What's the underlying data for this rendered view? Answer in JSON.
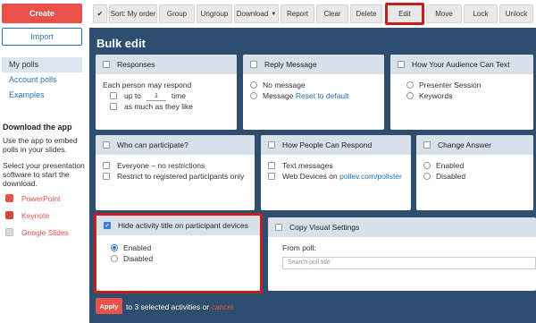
{
  "sidebar": {
    "create_label": "Create",
    "import_label": "Import",
    "nav": [
      {
        "label": "My polls",
        "active": true
      },
      {
        "label": "Account polls",
        "active": false
      },
      {
        "label": "Examples",
        "active": false
      }
    ],
    "download_title": "Download the app",
    "download_text1": "Use the app to embed polls in your slides.",
    "download_text2": "Select your presentation software to start the download.",
    "apps": [
      {
        "label": "PowerPoint",
        "icon": "powerpoint-icon"
      },
      {
        "label": "Keynote",
        "icon": "keynote-icon"
      },
      {
        "label": "Google Slides",
        "icon": "google-slides-icon"
      }
    ]
  },
  "toolbar": {
    "check_glyph": "✔",
    "sort_label": "Sort: My order",
    "group_label": "Group",
    "ungroup_label": "Ungroup",
    "download_label": "Download",
    "download_caret": "▼",
    "report_label": "Report",
    "clear_label": "Clear",
    "delete_label": "Delete",
    "edit_label": "Edit",
    "move_label": "Move",
    "lock_label": "Lock",
    "unlock_label": "Unlock"
  },
  "main": {
    "title": "Bulk edit",
    "responses": {
      "title": "Responses",
      "each_person": "Each person may respond",
      "up_to": "up to",
      "count": "1",
      "time": "time",
      "as_much": "as much as they like"
    },
    "reply": {
      "title": "Reply Message",
      "no_message": "No message",
      "message": "Message",
      "reset": "Reset to default"
    },
    "text_method": {
      "title": "How Your Audience Can Text",
      "presenter_session": "Presenter Session",
      "keywords": "Keywords"
    },
    "who": {
      "title": "Who can participate?",
      "everyone": "Everyone – no restrictions",
      "restrict": "Restrict to registered participants only"
    },
    "respond": {
      "title": "How People Can Respond",
      "text_messages": "Text messages",
      "web_devices": "Web Devices on",
      "web_link": "pollev.com/pollster"
    },
    "change": {
      "title": "Change Answer",
      "enabled": "Enabled",
      "disabled": "Disabled"
    },
    "hide": {
      "title": "Hide activity title on participant devices",
      "enabled": "Enabled",
      "disabled": "Disabled"
    },
    "copy": {
      "title": "Copy Visual Settings",
      "from_poll": "From poll:",
      "search_placeholder": "Search poll title"
    },
    "apply_label": "Apply",
    "apply_text": "to 3 selected activities or",
    "cancel_label": "cancel"
  },
  "colors": {
    "accent_red": "#e8524a",
    "panel_blue": "#2d4e6e",
    "highlight_frame": "#c41e1e",
    "link_blue": "#2a6fb0"
  }
}
